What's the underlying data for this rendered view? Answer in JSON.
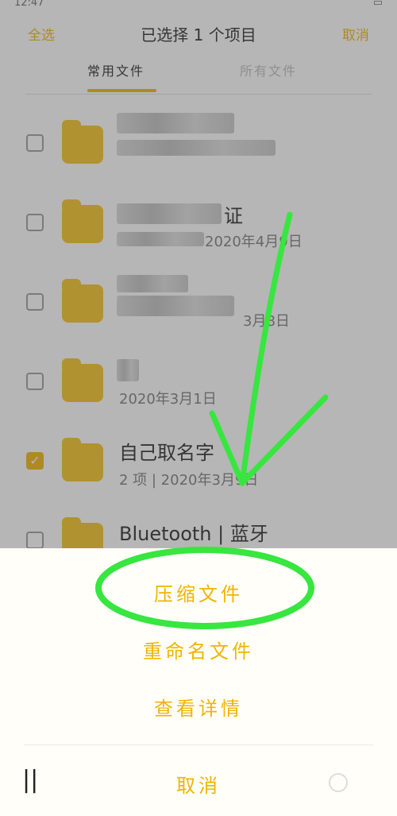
{
  "statusbar": {
    "time": "12:47",
    "right": "▭"
  },
  "header": {
    "select_all": "全选",
    "title": "已选择 1 个项目",
    "cancel": "取消"
  },
  "tabs": {
    "frequent": "常用文件",
    "all": "所有文件"
  },
  "rows": [
    {
      "name": "",
      "meta": "",
      "checked": false
    },
    {
      "name": "证",
      "meta": "2020年4月9日",
      "checked": false
    },
    {
      "name": "",
      "meta": "3月8日",
      "checked": false
    },
    {
      "name": "",
      "meta": "2020年3月1日",
      "checked": false
    },
    {
      "name": "自己取名字",
      "meta": "2 项 | 2020年3月9日",
      "checked": true
    },
    {
      "name": "Bluetooth | 蓝牙",
      "meta": "",
      "checked": false
    }
  ],
  "sheet": {
    "compress": "压缩文件",
    "rename": "重命名文件",
    "details": "查看详情",
    "cancel": "取消"
  },
  "colors": {
    "accent": "#f0b400",
    "annotation": "#37e63f"
  }
}
